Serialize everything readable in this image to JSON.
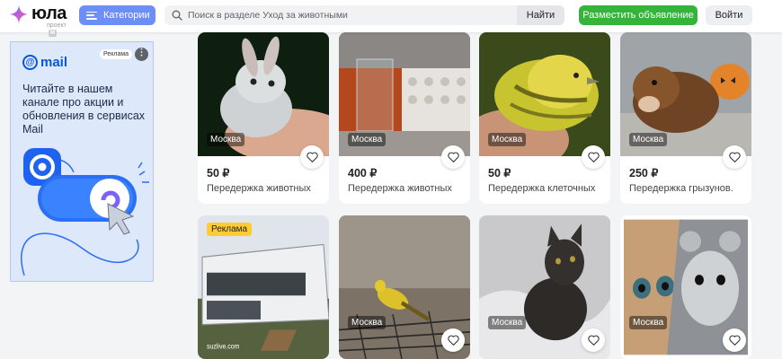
{
  "header": {
    "logo_text": "юла",
    "logo_sub": "проект",
    "logo_badge": "M",
    "categories_label": "Категории",
    "search_placeholder": "Поиск в разделе Уход за животными",
    "find_label": "Найти",
    "post_label": "Разместить объявление",
    "login_label": "Войти",
    "brand_color": "#6d8ef7",
    "post_color": "#34b53a"
  },
  "ad": {
    "brand": "mail",
    "badge": "Реклама",
    "text": "Читайте в нашем канале про акции и обновления в сервисах Mail"
  },
  "listings": [
    {
      "price": "50 ₽",
      "title": "Передержка животных",
      "city": "Москва"
    },
    {
      "price": "400 ₽",
      "title": "Передержка животных",
      "city": "Москва"
    },
    {
      "price": "50 ₽",
      "title": "Передержка клеточных",
      "city": "Москва"
    },
    {
      "price": "250 ₽",
      "title": "Передержка грызунов.",
      "city": "Москва"
    },
    {
      "promo": "Реклама",
      "watermark": "suzlive.com"
    },
    {
      "city": "Москва"
    },
    {
      "city": "Москва"
    },
    {
      "city": "Москва"
    }
  ]
}
